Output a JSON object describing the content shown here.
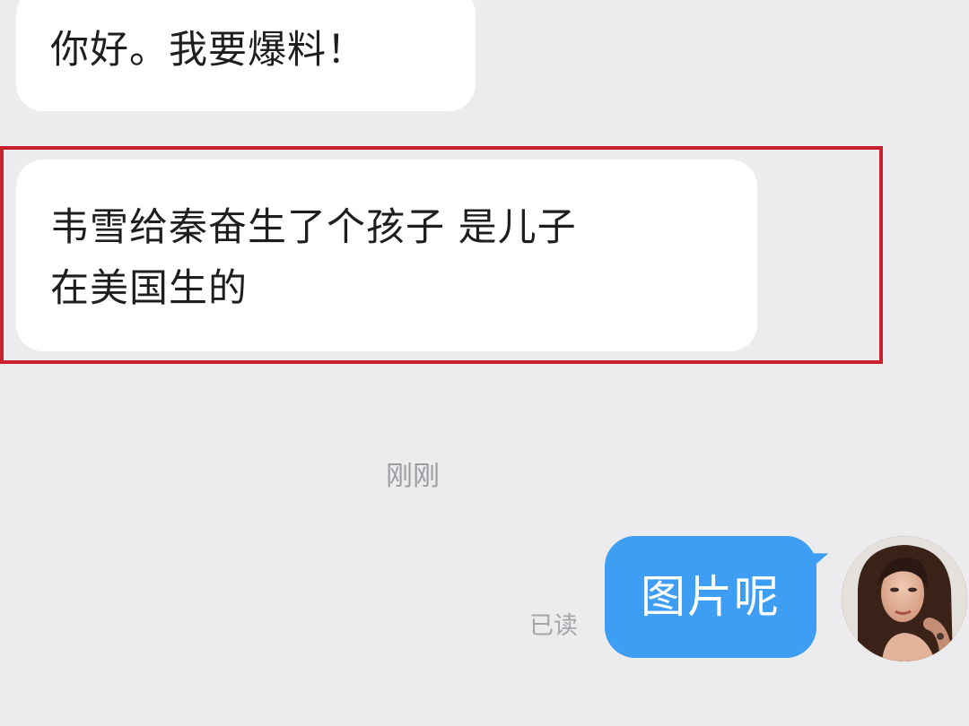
{
  "chat": {
    "incoming": [
      {
        "text": "你好。我要爆料！"
      },
      {
        "lines": [
          "韦雪给秦奋生了个孩子 是儿子",
          "在美国生的"
        ]
      }
    ],
    "timestamp": "刚刚",
    "outgoing": {
      "text": "图片呢",
      "status": "已读"
    }
  },
  "colors": {
    "background": "#ececee",
    "incoming_bubble": "#ffffff",
    "outgoing_bubble": "#3d9ef3",
    "highlight_border": "#c8202d"
  }
}
